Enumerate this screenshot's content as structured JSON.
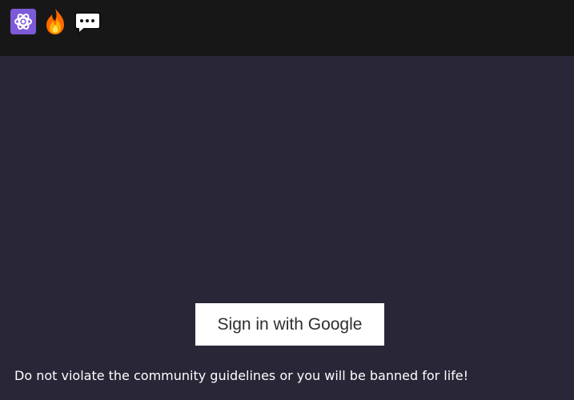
{
  "header": {
    "icons": [
      "atom-icon",
      "fire-icon",
      "speech-balloon-icon"
    ]
  },
  "auth": {
    "sign_in_label": "Sign in with Google"
  },
  "footer": {
    "guidelines_text": "Do not violate the community guidelines or you will be banned for life!"
  },
  "colors": {
    "header_bg": "#181717",
    "page_bg": "#282637",
    "button_bg": "#ffffff",
    "button_text": "#2f2f2f",
    "body_text": "#ffffff",
    "atom_bg": "#7d5ad8",
    "fire_orange": "#ff7a00"
  }
}
